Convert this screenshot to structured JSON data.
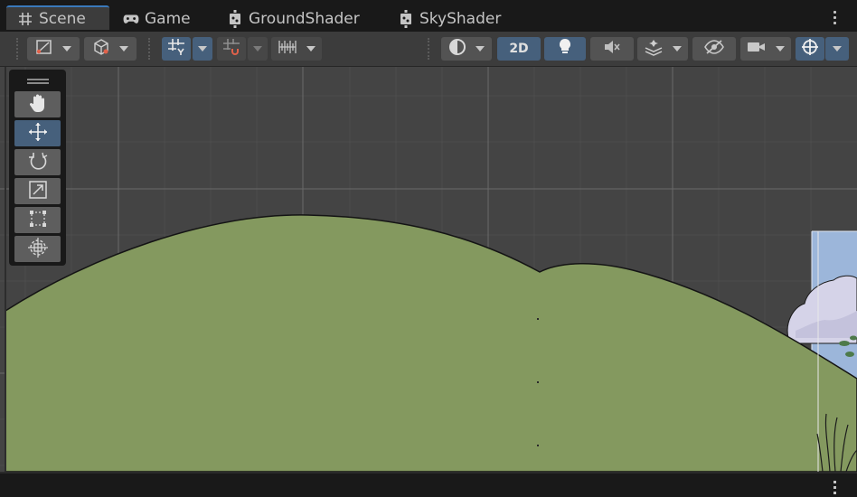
{
  "tabs": [
    {
      "label": "Scene",
      "icon": "grid-hash-icon",
      "active": true
    },
    {
      "label": "Game",
      "icon": "gamepad-icon",
      "active": false
    },
    {
      "label": "GroundShader",
      "icon": "shader-graph-icon",
      "active": false
    },
    {
      "label": "SkyShader",
      "icon": "shader-graph-icon",
      "active": false
    }
  ],
  "toolbar": {
    "mode_2d_label": "2D"
  },
  "tools": [
    {
      "name": "hand-tool",
      "icon": "hand-icon",
      "active": false
    },
    {
      "name": "move-tool",
      "icon": "move-arrows-icon",
      "active": true
    },
    {
      "name": "rotate-tool",
      "icon": "rotate-icon",
      "active": false
    },
    {
      "name": "scale-tool",
      "icon": "scale-icon",
      "active": false
    },
    {
      "name": "rect-tool",
      "icon": "rect-transform-icon",
      "active": false
    },
    {
      "name": "transform-tool",
      "icon": "transform-icon",
      "active": false
    }
  ],
  "colors": {
    "ground": "#84995f",
    "sky": "#9cb6da",
    "cloud": "#d5d3e8",
    "viewport_bg": "#444444",
    "accent": "#46607c"
  }
}
